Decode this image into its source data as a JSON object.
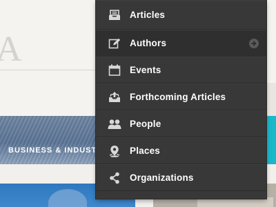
{
  "background": {
    "page_letter": "A",
    "banner_label": "BUSINESS & INDUST"
  },
  "menu": {
    "items": [
      {
        "label": "Articles",
        "icon": "tray-icon"
      },
      {
        "label": "Authors",
        "icon": "edit-icon",
        "active": true,
        "arrow": "arrow-right-circle-icon"
      },
      {
        "label": "Events",
        "icon": "calendar-icon"
      },
      {
        "label": "Forthcoming Articles",
        "icon": "inbox-upload-icon"
      },
      {
        "label": "People",
        "icon": "people-icon"
      },
      {
        "label": "Places",
        "icon": "map-pin-icon"
      },
      {
        "label": "Organizations",
        "icon": "share-icon"
      }
    ]
  },
  "colors": {
    "menu_bg": "#383838",
    "menu_active_bg": "#2f2f2f",
    "menu_text": "#ffffff",
    "icon": "#d8d8d8",
    "accent_teal": "#19b9c9"
  }
}
